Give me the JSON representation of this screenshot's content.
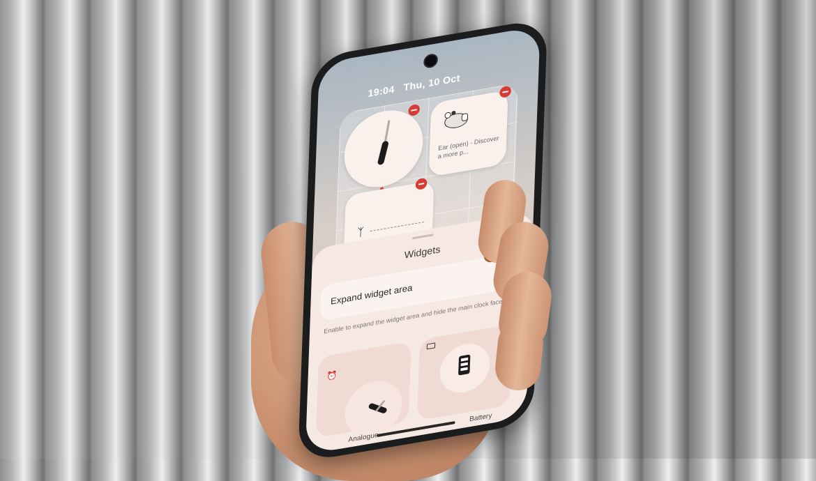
{
  "lockscreen": {
    "time": "19:04",
    "date": "Thu, 10 Oct",
    "widgets": [
      {
        "name": "analogue-clock"
      },
      {
        "name": "ear",
        "text": "Ear (open) - Discover a more p..."
      },
      {
        "name": "steps"
      }
    ]
  },
  "sheet": {
    "title": "Widgets",
    "toggle_label": "Expand widget area",
    "toggle_on": true,
    "description": "Enable to expand the widget area and hide the main clock face.",
    "tiles": [
      {
        "label": "Analogue",
        "icon": "alarm-clock-icon"
      },
      {
        "label": "Battery",
        "icon": "battery-icon"
      }
    ]
  },
  "colors": {
    "accent_toggle": "#a95a2f",
    "remove_badge": "#d63b34",
    "sheet_bg": "#f6e9e3"
  }
}
